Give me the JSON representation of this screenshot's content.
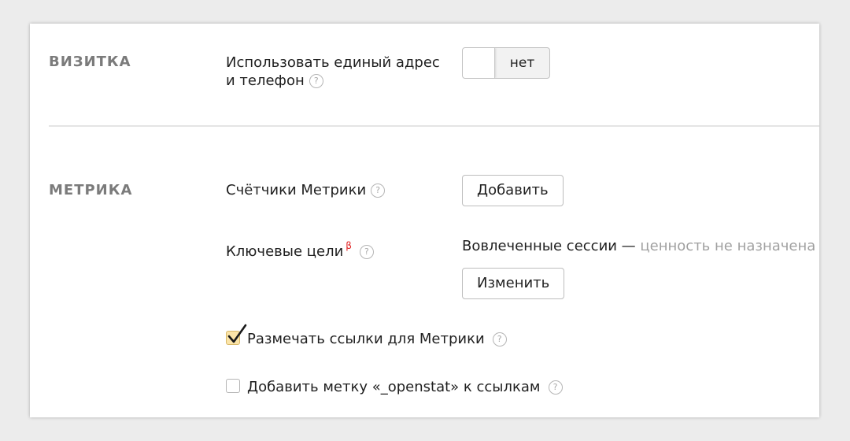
{
  "vizitka": {
    "title": "ВИЗИТКА",
    "setting_label_line1": "Использовать единый адрес",
    "setting_label_line2": "и телефон",
    "toggle_value": "нет"
  },
  "metrika": {
    "title": "МЕТРИКА",
    "counters_label": "Счётчики Метрики",
    "add_button": "Добавить",
    "key_goals_label": "Ключевые цели",
    "beta_mark": "β",
    "engaged_sessions": "Вовлеченные сессии —",
    "value_status": "ценность не назначена",
    "change_button": "Изменить",
    "checkbox_mark_links": {
      "label": "Размечать ссылки для Метрики",
      "checked": true
    },
    "checkbox_openstat": {
      "label": "Добавить метку «_openstat» к ссылкам",
      "checked": false
    }
  },
  "help_glyph": "?",
  "icons": {
    "help": "question-circle-icon",
    "check": "checkmark-icon"
  },
  "colors": {
    "section_title": "#7b7b7b",
    "checkbox_checked_fill": "#fbe4a8",
    "beta": "#e02020",
    "muted_text": "#a0a0a0"
  }
}
